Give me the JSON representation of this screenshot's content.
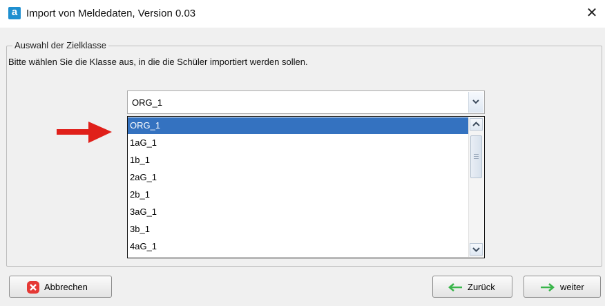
{
  "window": {
    "title": "Import von Meldedaten, Version 0.03",
    "app_icon_letter": "a",
    "close_glyph": "✕"
  },
  "group": {
    "legend": "Auswahl der Zielklasse",
    "instruction": "Bitte wählen Sie die Klasse aus, in die die Schüler importiert werden sollen."
  },
  "combo": {
    "selected_value": "ORG_1",
    "options": [
      "ORG_1",
      "1aG_1",
      "1b_1",
      "2aG_1",
      "2b_1",
      "3aG_1",
      "3b_1",
      "4aG_1"
    ],
    "highlighted_index": 0
  },
  "buttons": {
    "cancel_label": "Abbrechen",
    "back_label": "Zurück",
    "next_label": "weiter"
  },
  "colors": {
    "selection": "#3472c0",
    "arrow": "#e0201a",
    "nav_arrow": "#39b54a",
    "cancel_icon": "#e53935"
  },
  "icons": {
    "cancel": "cancel-x-icon",
    "back": "arrow-left-icon",
    "next": "arrow-right-icon",
    "pointer": "red-pointer-arrow-icon"
  }
}
